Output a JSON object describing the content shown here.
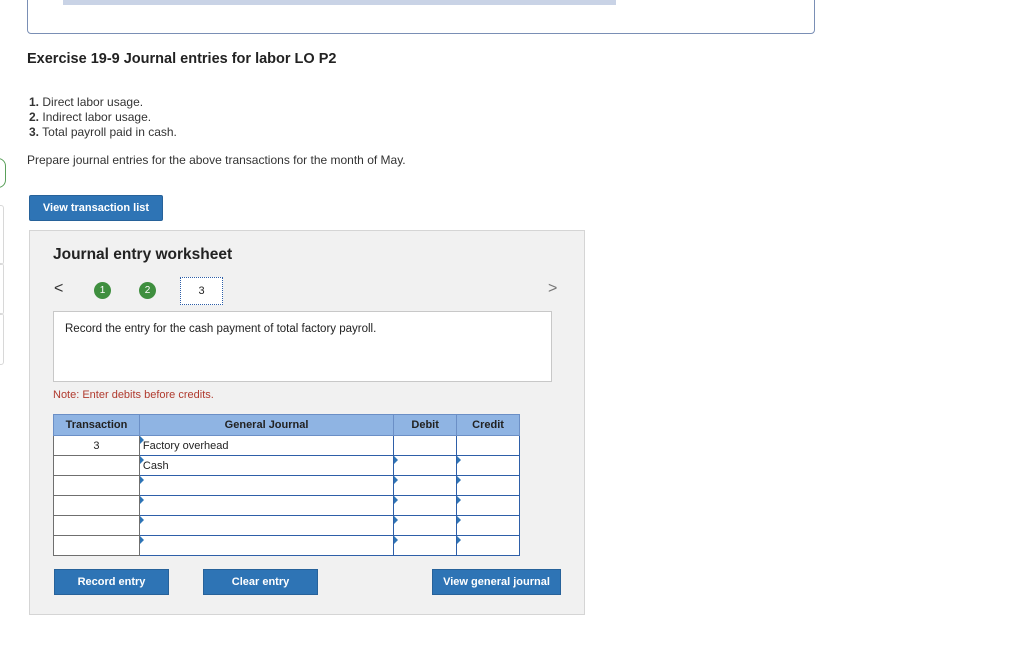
{
  "exercise": {
    "title": "Exercise 19-9 Journal entries for labor LO P2",
    "items": [
      {
        "num": "1.",
        "text": "Direct labor usage."
      },
      {
        "num": "2.",
        "text": "Indirect labor usage."
      },
      {
        "num": "3.",
        "text": "Total payroll paid in cash."
      }
    ],
    "prompt": "Prepare journal entries for the above transactions for the month of May."
  },
  "buttons": {
    "view_transactions": "View transaction list",
    "record_entry": "Record entry",
    "clear_entry": "Clear entry",
    "view_general_journal": "View general journal"
  },
  "worksheet": {
    "title": "Journal entry worksheet",
    "nav": {
      "prev": "<",
      "next": ">"
    },
    "steps": [
      "1",
      "2",
      "3"
    ],
    "active_step": "3",
    "instruction": "Record the entry for the cash payment of total factory payroll.",
    "note": "Note: Enter debits before credits.",
    "table": {
      "headers": {
        "transaction": "Transaction",
        "journal": "General Journal",
        "debit": "Debit",
        "credit": "Credit"
      },
      "rows": [
        {
          "transaction": "3",
          "account": "Factory overhead",
          "debit": "",
          "credit": ""
        },
        {
          "transaction": "",
          "account": "Cash",
          "debit": "",
          "credit": ""
        },
        {
          "transaction": "",
          "account": "",
          "debit": "",
          "credit": ""
        },
        {
          "transaction": "",
          "account": "",
          "debit": "",
          "credit": ""
        },
        {
          "transaction": "",
          "account": "",
          "debit": "",
          "credit": ""
        },
        {
          "transaction": "",
          "account": "",
          "debit": "",
          "credit": ""
        }
      ]
    }
  },
  "colors": {
    "accent": "#2e74b5",
    "step_done": "#3f8f3f",
    "note": "#b03a2e",
    "header_bg": "#8fb4e3"
  }
}
